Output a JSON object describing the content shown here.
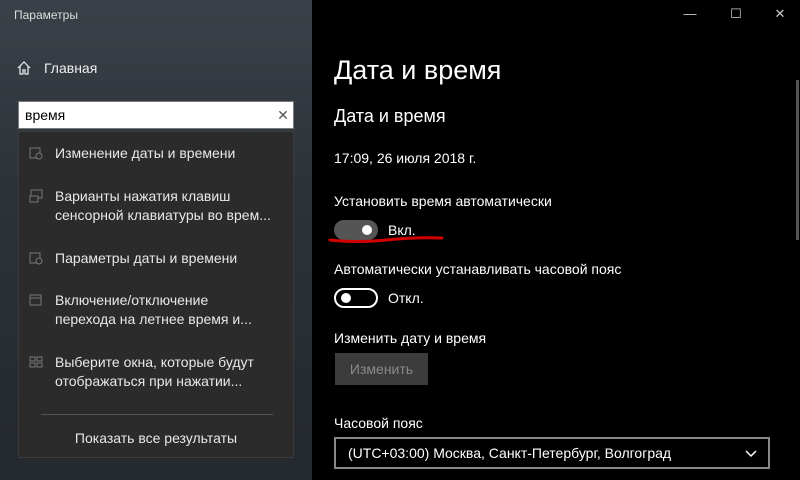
{
  "window": {
    "title": "Параметры",
    "minimize_icon": "minimize-icon",
    "maximize_icon": "maximize-icon",
    "close_icon": "close-icon"
  },
  "sidebar": {
    "home_label": "Главная",
    "search": {
      "value": "время",
      "placeholder": ""
    },
    "suggestions": [
      {
        "lines": [
          "Изменение даты и времени"
        ],
        "icon": "calendar-clock-icon"
      },
      {
        "lines": [
          "Варианты нажатия клавиш",
          "сенсорной клавиатуры во врем..."
        ],
        "icon": "keyboard-icon"
      },
      {
        "lines": [
          "Параметры даты и времени"
        ],
        "icon": "calendar-clock-icon"
      },
      {
        "lines": [
          "Включение/отключение",
          "перехода на летнее время и..."
        ],
        "icon": "calendar-icon"
      },
      {
        "lines": [
          "Выберите окна, которые будут",
          "отображаться при нажатии..."
        ],
        "icon": "window-grid-icon"
      }
    ],
    "show_all": "Показать все результаты"
  },
  "main": {
    "page_title": "Дата и время",
    "section_title": "Дата и время",
    "current_datetime": "17:09, 26 июля 2018 г.",
    "auto_time": {
      "label": "Установить время автоматически",
      "state": "Вкл.",
      "on": true
    },
    "auto_tz": {
      "label": "Автоматически устанавливать часовой пояс",
      "state": "Откл.",
      "on": false
    },
    "change": {
      "label": "Изменить дату и время",
      "button": "Изменить"
    },
    "timezone": {
      "label": "Часовой пояс",
      "value": "(UTC+03:00) Москва, Санкт-Петербург, Волгоград"
    }
  },
  "colors": {
    "annotation": "#d40000",
    "toggle_on_bg": "#555555"
  }
}
